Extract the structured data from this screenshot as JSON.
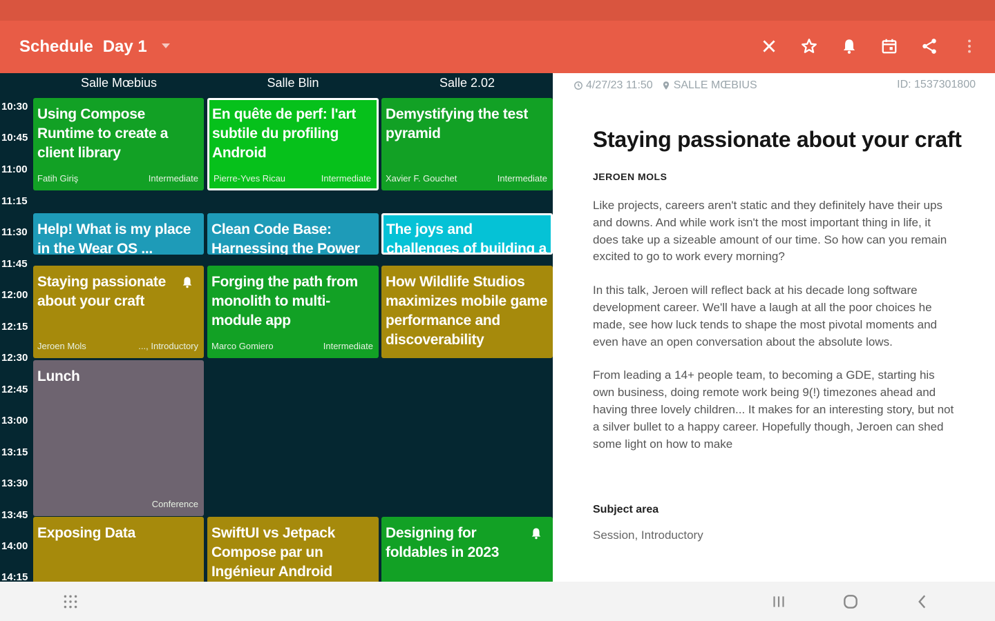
{
  "app_bar": {
    "title": "Schedule",
    "day": "Day 1",
    "actions": [
      "close-icon",
      "star-icon",
      "bell-icon",
      "calendar-icon",
      "share-icon",
      "more-vert-icon"
    ]
  },
  "colors": {
    "app_bar": "#e85c46",
    "status_bar": "#d9553f",
    "schedule_bg": "#052731",
    "green": "#12a125",
    "bright_green": "#06c11b",
    "teal": "#1e9bb8",
    "cyan": "#05c2d6",
    "olive": "#a68a0c",
    "gray": "#6e6470"
  },
  "rooms": [
    "Salle Mœbius",
    "Salle Blin",
    "Salle 2.02"
  ],
  "times": [
    "10:30",
    "10:45",
    "11:00",
    "11:15",
    "11:30",
    "11:45",
    "12:00",
    "12:15",
    "12:30",
    "12:45",
    "13:00",
    "13:15",
    "13:30",
    "13:45",
    "14:00",
    "14:15"
  ],
  "sessions": [
    {
      "title": "Using Compose Runtime to create a client library",
      "speaker": "Fatih Giriş",
      "level": "Intermediate"
    },
    {
      "title": "En quête de perf: l'art subtile du profiling Android",
      "speaker": "Pierre-Yves Ricau",
      "level": "Intermediate"
    },
    {
      "title": "Demystifying the test pyramid",
      "speaker": "Xavier F. Gouchet",
      "level": "Intermediate"
    },
    {
      "title": "Help! What is my place in the Wear OS ...",
      "speaker": "",
      "level": ""
    },
    {
      "title": "Clean Code Base: Harnessing the Power of ...",
      "speaker": "",
      "level": ""
    },
    {
      "title": "The joys and challenges of building a ...",
      "speaker": "",
      "level": ""
    },
    {
      "title": "Staying passionate about your craft",
      "speaker": "Jeroen Mols",
      "level": "..., Introductory"
    },
    {
      "title": "Forging the path from monolith to multi-module app",
      "speaker": "Marco Gomiero",
      "level": "Intermediate"
    },
    {
      "title": "How Wildlife Studios maximizes mobile game performance and discoverability",
      "speaker": "",
      "level": ""
    },
    {
      "title": "Lunch",
      "speaker": "",
      "level": "Conference"
    },
    {
      "title": "Exposing Data",
      "speaker": "",
      "level": ""
    },
    {
      "title": "SwiftUI vs Jetpack Compose par un Ingénieur Android",
      "speaker": "",
      "level": ""
    },
    {
      "title": "Designing for foldables in 2023",
      "speaker": "",
      "level": ""
    }
  ],
  "detail": {
    "timestamp": "4/27/23 11:50",
    "room": "SALLE MŒBIUS",
    "id": "ID: 1537301800",
    "title": "Staying passionate about your craft",
    "speaker": "JEROEN MOLS",
    "paragraphs": [
      "Like projects, careers aren't static and they definitely have their ups and downs. And while work isn't the most important thing in life, it does take up a sizeable amount of our time. So how can you remain excited to go to work every morning?",
      "In this talk, Jeroen will reflect back at his decade long software development career. We'll have a laugh at all the poor choices he made, see how luck tends to shape the most pivotal moments and even have an open conversation about the absolute lows.",
      "From leading a 14+ people team, to becoming a GDE, starting his own business, doing remote work being 9(!) timezones ahead and having three lovely children... It makes for an interesting story, but not a silver bullet to a happy career. Hopefully though, Jeroen can shed some light on how to make"
    ],
    "subject_label": "Subject area",
    "subject_value": "Session, Introductory"
  },
  "nav": [
    "apps-grid-icon",
    "recents-icon",
    "home-icon",
    "back-icon"
  ]
}
